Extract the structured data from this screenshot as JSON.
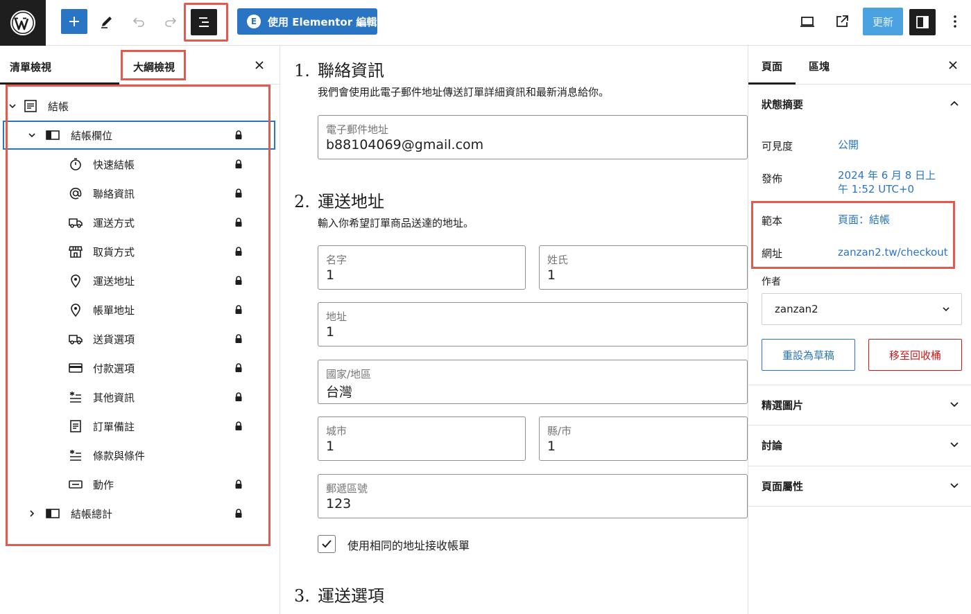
{
  "toolbar": {
    "elementor_label": "使用 Elementor 編輯",
    "elementor_badge": "E",
    "update_label": "更新"
  },
  "left_panel": {
    "tab_list": "清單檢視",
    "tab_outline": "大綱檢視",
    "items": [
      {
        "label": "結帳",
        "icon": "page-icon",
        "level": 0,
        "expanded": true,
        "locked": false
      },
      {
        "label": "結帳欄位",
        "icon": "columns-icon",
        "level": 1,
        "expanded": true,
        "locked": true
      },
      {
        "label": "快速結帳",
        "icon": "stopwatch-icon",
        "level": 2,
        "locked": true
      },
      {
        "label": "聯絡資訊",
        "icon": "at-icon",
        "level": 2,
        "locked": true
      },
      {
        "label": "運送方式",
        "icon": "truck-icon",
        "level": 2,
        "locked": true
      },
      {
        "label": "取貨方式",
        "icon": "store-icon",
        "level": 2,
        "locked": true
      },
      {
        "label": "運送地址",
        "icon": "pin-icon",
        "level": 2,
        "locked": true
      },
      {
        "label": "帳單地址",
        "icon": "pin-icon",
        "level": 2,
        "locked": true
      },
      {
        "label": "送貨選項",
        "icon": "truck-icon",
        "level": 2,
        "locked": true
      },
      {
        "label": "付款選項",
        "icon": "card-icon",
        "level": 2,
        "locked": true
      },
      {
        "label": "其他資訊",
        "icon": "asterisk-lines-icon",
        "level": 2,
        "locked": true
      },
      {
        "label": "訂單備註",
        "icon": "note-icon",
        "level": 2,
        "locked": true
      },
      {
        "label": "條款與條件",
        "icon": "asterisk-lines-icon",
        "level": 2,
        "locked": false
      },
      {
        "label": "動作",
        "icon": "button-icon",
        "level": 2,
        "locked": true
      },
      {
        "label": "結帳總計",
        "icon": "columns-icon",
        "level": 1,
        "expanded": false,
        "locked": true
      }
    ]
  },
  "canvas": {
    "sections": [
      {
        "num": "1.",
        "title": "聯絡資訊",
        "desc": "我們會使用此電子郵件地址傳送訂單詳細資訊和最新消息給你。"
      },
      {
        "num": "2.",
        "title": "運送地址",
        "desc": "輸入你希望訂單商品送達的地址。"
      },
      {
        "num": "3.",
        "title": "運送選項",
        "desc": ""
      }
    ],
    "fields": {
      "email": {
        "label": "電子郵件地址",
        "value": "b88104069@gmail.com"
      },
      "first_name": {
        "label": "名字",
        "value": "1"
      },
      "last_name": {
        "label": "姓氏",
        "value": "1"
      },
      "address": {
        "label": "地址",
        "value": "1"
      },
      "country": {
        "label": "國家/地區",
        "value": "台灣"
      },
      "city": {
        "label": "城市",
        "value": "1"
      },
      "county": {
        "label": "縣/市",
        "value": "1"
      },
      "postcode": {
        "label": "郵遞區號",
        "value": "123"
      }
    },
    "same_address_label": "使用相同的地址接收帳單",
    "same_address_checked": true
  },
  "right_panel": {
    "tab_page": "頁面",
    "tab_block": "區塊",
    "status_title": "狀態摘要",
    "visibility_label": "可見度",
    "visibility_value": "公開",
    "publish_label": "發佈",
    "publish_value_1": "2024 年 6 月 8 日上",
    "publish_value_2": "午 1:52 UTC+0",
    "template_label": "範本",
    "template_value": "頁面：結帳",
    "url_label": "網址",
    "url_value": "zanzan2.tw/checkout",
    "author_label": "作者",
    "author_value": "zanzan2",
    "draft_button": "重設為草稿",
    "trash_button": "移至回收桶",
    "featured_image": "精選圖片",
    "discussion": "討論",
    "page_attributes": "頁面屬性"
  },
  "colors": {
    "accent": "#2a74c4",
    "highlight": "#e05a4f",
    "danger": "#cc1818",
    "dark": "#1e1e1e"
  }
}
